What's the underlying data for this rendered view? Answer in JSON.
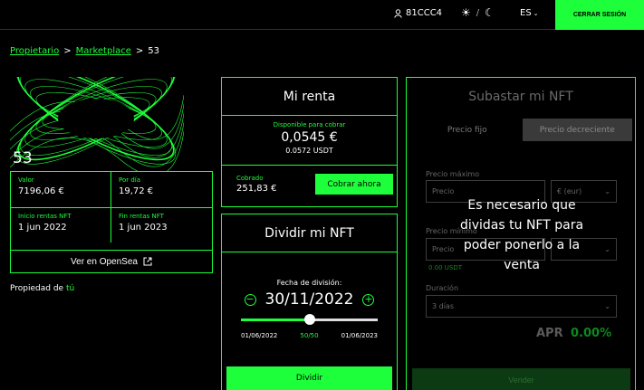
{
  "header": {
    "user": "81CCC4",
    "lang": "ES",
    "logout": "CERRAR SESIÓN"
  },
  "breadcrumb": {
    "items": [
      "Propietario",
      "Marketplace",
      "53"
    ],
    "sep": ">"
  },
  "nft": {
    "number": "53",
    "stats": [
      {
        "label": "Valor",
        "value": "7196,06 €"
      },
      {
        "label": "Por día",
        "value": "19,72 €"
      },
      {
        "label": "Inicio rentas NFT",
        "value": "1 jun 2022"
      },
      {
        "label": "Fin rentas NFT",
        "value": "1 jun 2023"
      }
    ],
    "opensea": "Ver en OpenSea",
    "owner_label": "Propiedad de",
    "owner": "tú"
  },
  "renta": {
    "title": "Mi renta",
    "available_label": "Disponible para cobrar",
    "available_eur": "0,0545 €",
    "available_usdt": "0.0572 USDT",
    "collected_label": "Cobrado",
    "collected": "251,83 €",
    "collect_btn": "Cobrar ahora"
  },
  "dividir": {
    "title": "Dividir mi NFT",
    "date_label": "Fecha de división:",
    "date": "30/11/2022",
    "slider": {
      "min_label": "01/06/2022",
      "mid_label": "50/50",
      "max_label": "01/06/2023",
      "fraction": 0.5
    },
    "button": "Dividir"
  },
  "subastar": {
    "title": "Subastar mi NFT",
    "tabs": [
      "Precio fijo",
      "Precio decreciente"
    ],
    "max_label": "Precio máximo",
    "max_placeholder": "Precio",
    "currency": "€ (eur)",
    "min_label": "Precio mínimo",
    "min_placeholder": "Precio",
    "usdt": "0.00 USDT",
    "duration_label": "Duración",
    "duration": "3 días",
    "apr_label": "APR",
    "apr_value": "0.00%",
    "sell_btn": "Vender",
    "overlay": "Es necesario que dividas tu NFT para poder ponerlo a la venta"
  },
  "colors": {
    "accent": "#1dff3a",
    "background": "#000000"
  }
}
